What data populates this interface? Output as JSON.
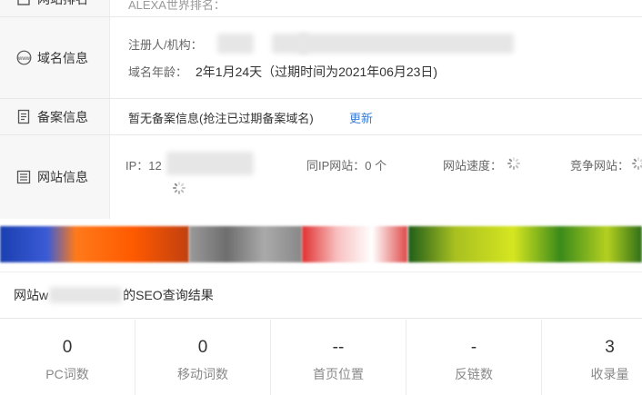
{
  "alexa_row": {
    "label": "网站排名",
    "content": "ALEXA世界排名："
  },
  "domain_row": {
    "label": "域名信息",
    "icon": "www-icon",
    "registrant_label": "注册人/机构：",
    "age_label": "域名年龄：",
    "age_value": "2年1月24天（过期时间为2021年06月23日)"
  },
  "beian_row": {
    "label": "备案信息",
    "icon": "document-icon",
    "text": "暂无备案信息(抢注已过期备案域名)",
    "update_link": "更新"
  },
  "site_row": {
    "label": "网站信息",
    "icon": "list-icon",
    "ip_label": "IP：12",
    "same_ip_label": "同IP网站：0 个",
    "speed_label": "网站速度：",
    "competitor_label": "竞争网站："
  },
  "seo": {
    "title_prefix": "网站w",
    "title_suffix": "的SEO查询结果"
  },
  "stats": [
    {
      "value": "0",
      "label": "PC词数"
    },
    {
      "value": "0",
      "label": "移动词数"
    },
    {
      "value": "--",
      "label": "首页位置"
    },
    {
      "value": "-",
      "label": "反链数"
    },
    {
      "value": "3",
      "label": "收录量"
    }
  ],
  "colors": {
    "link": "#3a7bd5",
    "label_bg": "#f7f7f7",
    "border": "#e8e8e8"
  }
}
